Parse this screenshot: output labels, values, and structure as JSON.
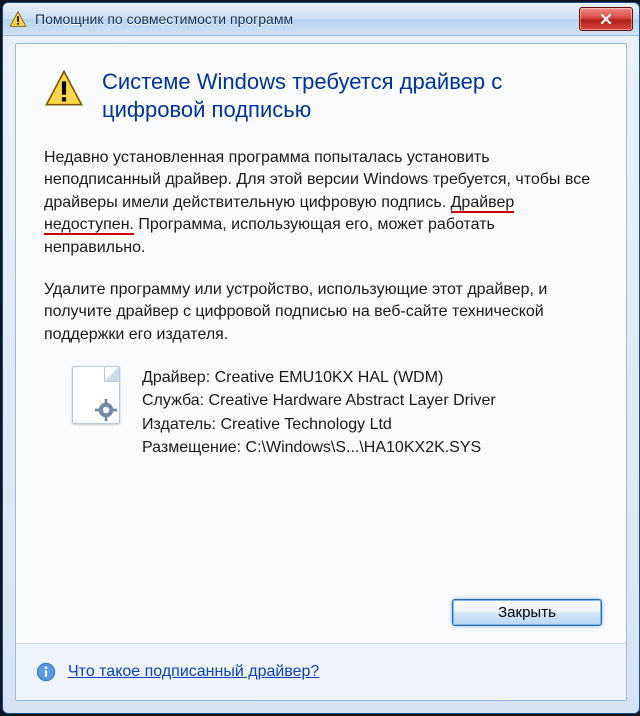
{
  "window": {
    "title": "Помощник по совместимости программ"
  },
  "heading": "Системе Windows требуется драйвер с цифровой подписью",
  "para1": {
    "pre": "Недавно установленная программа попыталась установить неподписанный драйвер. Для этой версии Windows требуется, чтобы все драйверы имели действительную цифровую подпись. ",
    "red1": "Драйвер",
    "mid": " ",
    "red2": "недоступен.",
    "post": " Программа, использующая его, может работать неправильно."
  },
  "para2": "Удалите программу или устройство, использующие этот драйвер, и получите драйвер с цифровой подписью на веб-сайте технической поддержки его издателя.",
  "details": {
    "driver_label": "Драйвер:",
    "driver_value": "Creative EMU10KX HAL (WDM)",
    "service_label": "Служба:",
    "service_value": "Creative Hardware Abstract Layer Driver",
    "publisher_label": "Издатель:",
    "publisher_value": "Creative Technology Ltd",
    "location_label": "Размещение:",
    "location_value": "C:\\Windows\\S...\\HA10KX2K.SYS"
  },
  "buttons": {
    "close": "Закрыть"
  },
  "footer_link": "Что такое подписанный драйвер?"
}
